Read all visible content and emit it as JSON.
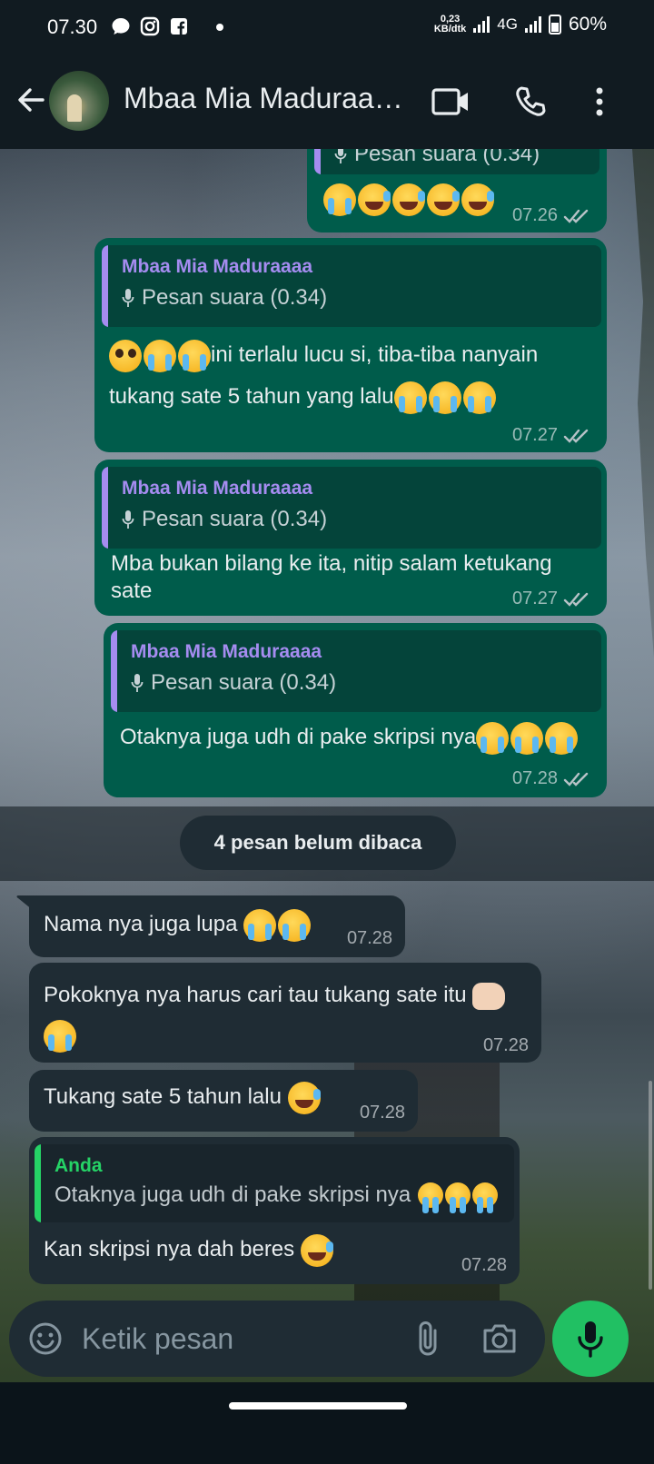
{
  "status_bar": {
    "time": "07.30",
    "speed_value": "0,23",
    "speed_unit": "KB/dtk",
    "network": "4G",
    "battery": "60%"
  },
  "header": {
    "contact_name": "Mbaa Mia Maduraa…",
    "icons": [
      "back-arrow-icon",
      "video-call-icon",
      "voice-call-icon",
      "more-options-icon"
    ]
  },
  "messages": [
    {
      "direction": "outgoing",
      "quote_sub": "Pesan suara (0.34)",
      "emojis": [
        "laugh",
        "laugh",
        "laugh",
        "laugh",
        "laugh"
      ],
      "time": "07.26",
      "status": "read"
    },
    {
      "direction": "outgoing",
      "quote_name": "Mbaa Mia Maduraaaa",
      "quote_sub": "Pesan suara (0.34)",
      "text": "ini terlalu lucu si, tiba-tiba nanyain tukang sate 5 tahun yang lalu",
      "text_line1": "ini terlalu lucu si, tiba-tiba nanyain",
      "text_line2": "tukang sate 5 tahun yang lalu",
      "time": "07.27",
      "status": "read"
    },
    {
      "direction": "outgoing",
      "quote_name": "Mbaa Mia Maduraaaa",
      "quote_sub": "Pesan suara (0.34)",
      "text": "Mba bukan bilang ke ita, nitip salam ketukang sate",
      "text_line1": "Mba bukan bilang ke ita, nitip salam ketukang",
      "text_line2": "sate",
      "time": "07.27",
      "status": "read"
    },
    {
      "direction": "outgoing",
      "quote_name": "Mbaa Mia Maduraaaa",
      "quote_sub": "Pesan suara (0.34)",
      "text": "Otaknya juga udh di pake skripsi nya",
      "time": "07.28",
      "status": "read"
    },
    {
      "direction": "incoming",
      "text": "Nama nya juga lupa",
      "time": "07.28"
    },
    {
      "direction": "incoming",
      "text": "Pokoknya nya harus cari tau tukang sate itu",
      "time": "07.28"
    },
    {
      "direction": "incoming",
      "text": "Tukang sate 5 tahun lalu",
      "time": "07.28"
    },
    {
      "direction": "incoming",
      "quote_name": "Anda",
      "quote_text": "Otaknya juga udh di pake skripsi nya",
      "text": "Kan skripsi nya dah beres",
      "time": "07.28"
    }
  ],
  "unread_banner": "4 pesan belum dibaca",
  "composer": {
    "placeholder": "Ketik pesan"
  },
  "colors": {
    "outgoing_bubble": "#005c4b",
    "incoming_bubble": "#1f2c34",
    "quote_name_purple": "#a58cf0",
    "quote_name_green": "#25d366",
    "mic_button": "#21c063"
  }
}
